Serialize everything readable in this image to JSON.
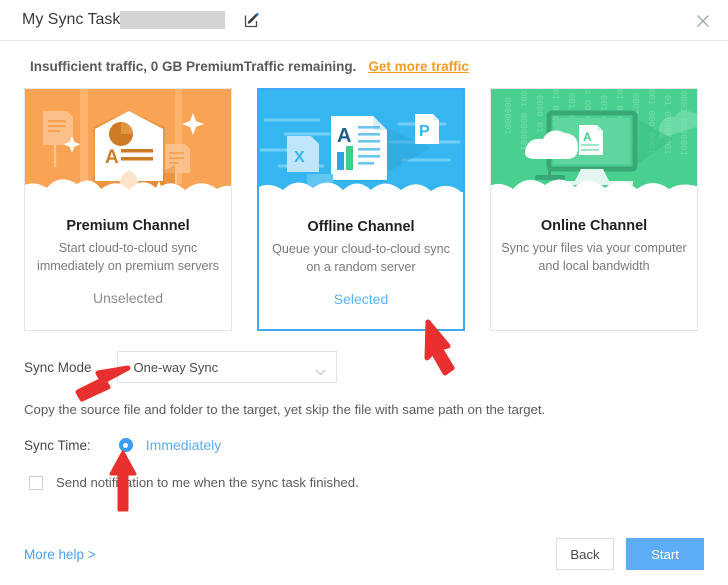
{
  "window": {
    "title": "My Sync Task",
    "title_redacted": true,
    "edit_icon": "edit-pencil-icon",
    "close_icon": "close-icon"
  },
  "notice": {
    "text": "Insufficient traffic, 0 GB PremiumTraffic remaining.",
    "link_label": "Get more traffic",
    "link_color": "#f59a23"
  },
  "channels": [
    {
      "key": "premium",
      "title": "Premium Channel",
      "desc": "Start cloud-to-cloud sync immediately on premium servers",
      "status": "Unselected",
      "selected": false,
      "art": "rocket-document-illustration",
      "color": "#f9a455"
    },
    {
      "key": "offline",
      "title": "Offline Channel",
      "desc": "Queue your cloud-to-cloud sync on a random server",
      "status": "Selected",
      "selected": true,
      "art": "flying-documents-illustration",
      "color": "#35b6f0"
    },
    {
      "key": "online",
      "title": "Online Channel",
      "desc": "Sync your files via your computer and local bandwidth",
      "status": "",
      "selected": false,
      "art": "monitor-cloud-illustration",
      "color": "#49cf90"
    }
  ],
  "form": {
    "sync_mode_label": "Sync Mode",
    "sync_mode_value": "One-way Sync",
    "sync_mode_options": [
      "One-way Sync"
    ],
    "sync_mode_help": "Copy the source file and folder to the target, yet skip the file with same path on the target.",
    "sync_time_label": "Sync Time:",
    "sync_time_value": "Immediately",
    "sync_time_checked": true,
    "notify_label": "Send notification to me when the sync task finished.",
    "notify_checked": false
  },
  "footer": {
    "more_help_label": "More help >",
    "back_label": "Back",
    "start_label": "Start",
    "start_color": "#5cadf5"
  },
  "annotations": {
    "arrow_color": "#e8312f",
    "arrows": [
      "arrow-to-offline-card",
      "arrow-to-sync-mode-dropdown",
      "arrow-to-sync-time-radio"
    ]
  }
}
